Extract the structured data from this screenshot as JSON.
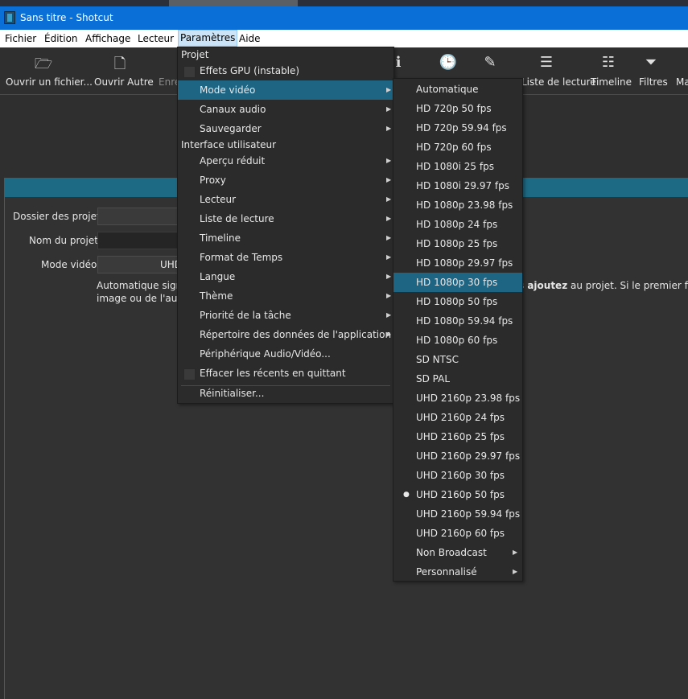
{
  "window": {
    "title": "Sans titre - Shotcut"
  },
  "menubar": [
    "Fichier",
    "Édition",
    "Affichage",
    "Lecteur",
    "Paramètres",
    "Aide"
  ],
  "toolbar": {
    "open_file": "Ouvrir un fichier...",
    "open_other": "Ouvrir Autre",
    "save": "Enre",
    "history": "",
    "playlist": "Liste de lecture",
    "timeline": "Timeline",
    "filters": "Filtres",
    "more": "Ma"
  },
  "form": {
    "project_folder_label": "Dossier des projets",
    "project_name_label": "Nom du projet",
    "video_mode_label": "Mode vidéo",
    "video_mode_value": "UHD",
    "desc_line1": "Automatique signi",
    "desc_line1_bold": "s ajoutez",
    "desc_line1_end": " au projet. Si le premier fichier",
    "desc_line2": "image ou de l'audi"
  },
  "settings_menu": {
    "section_project": "Projet",
    "gpu_effects": "Effets GPU (instable)",
    "video_mode": "Mode vidéo",
    "audio_channels": "Canaux audio",
    "backup": "Sauvegarder",
    "section_ui": "Interface utilisateur",
    "preview": "Aperçu réduit",
    "proxy": "Proxy",
    "player": "Lecteur",
    "playlist": "Liste de lecture",
    "timeline": "Timeline",
    "time_format": "Format de Temps",
    "language": "Langue",
    "theme": "Thème",
    "task_priority": "Priorité de la tâche",
    "app_data_dir": "Répertoire des données de l'application",
    "av_device": "Périphérique Audio/Vidéo...",
    "clear_recent": "Effacer les récents en quittant",
    "reset": "Réinitialiser..."
  },
  "video_modes": [
    "Automatique",
    "HD 720p 50 fps",
    "HD 720p 59.94 fps",
    "HD 720p 60 fps",
    "HD 1080i 25 fps",
    "HD 1080i 29.97 fps",
    "HD 1080p 23.98 fps",
    "HD 1080p 24 fps",
    "HD 1080p 25 fps",
    "HD 1080p 29.97 fps",
    "HD 1080p 30 fps",
    "HD 1080p 50 fps",
    "HD 1080p 59.94 fps",
    "HD 1080p 60 fps",
    "SD NTSC",
    "SD PAL",
    "UHD 2160p 23.98 fps",
    "UHD 2160p 24 fps",
    "UHD 2160p 25 fps",
    "UHD 2160p 29.97 fps",
    "UHD 2160p 30 fps",
    "UHD 2160p 50 fps",
    "UHD 2160p 59.94 fps",
    "UHD 2160p 60 fps",
    "Non Broadcast",
    "Personnalisé"
  ],
  "colors": {
    "titlebar": "#0a6fd6",
    "highlight": "#1e6483",
    "panel_header": "#1d6a85"
  }
}
